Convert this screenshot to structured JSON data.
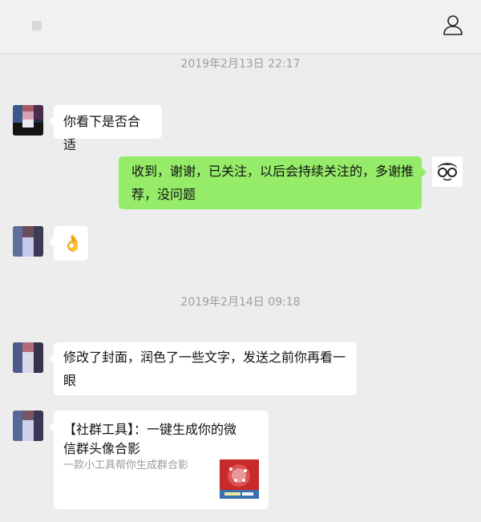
{
  "header": {
    "profile_icon": "person-outline-icon"
  },
  "timestamps": [
    "2019年2月13日 22:17",
    "2019年2月14日 09:18"
  ],
  "messages": [
    {
      "sender": "contact",
      "text": "你看下是否合适"
    },
    {
      "sender": "me",
      "line1": "收到，谢谢，已关注，以后会持续关注的，多谢推",
      "line2": "荐，没问题"
    },
    {
      "sender": "contact",
      "emoji": "👌"
    },
    {
      "sender": "contact",
      "line1": "修改了封面，润色了一些文字，发送之前你再看一",
      "line2": "眼"
    },
    {
      "sender": "contact",
      "link_card": {
        "title_line1": "【社群工具】：一键生成你的微",
        "title_line2": "信群头像合影",
        "description": "一款小工具帮你生成群合影"
      }
    }
  ],
  "colors": {
    "my_bubble": "#95ec69",
    "their_bubble": "#ffffff",
    "background": "#ededed"
  }
}
